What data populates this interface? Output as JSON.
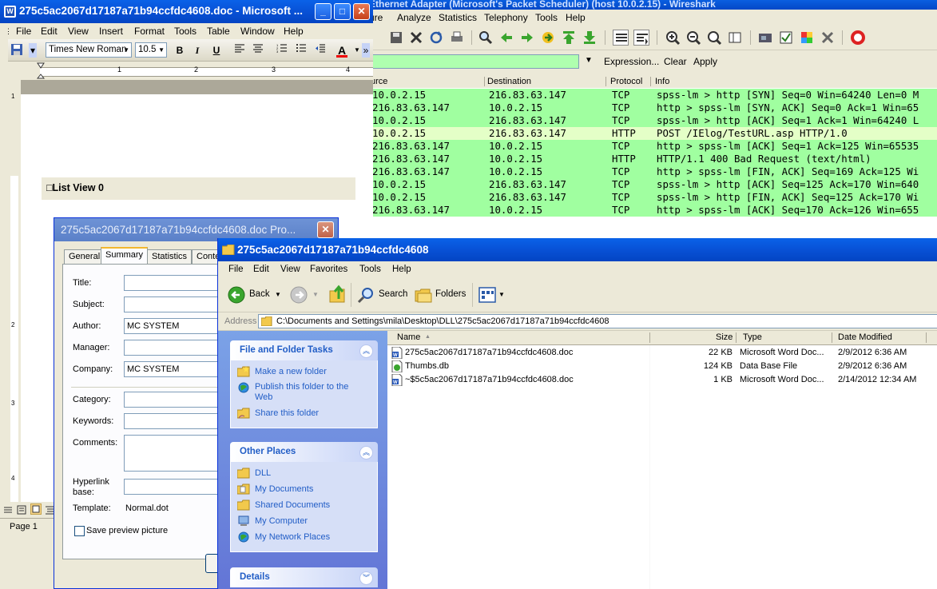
{
  "wireshark": {
    "title_fragment": "Ethernet Adapter (Microsoft's Packet Scheduler)  (host 10.0.2.15) - Wireshark",
    "menu": [
      "ure",
      "Analyze",
      "Statistics",
      "Telephony",
      "Tools",
      "Help"
    ],
    "filter": {
      "value": "",
      "expression_label": "Expression...",
      "clear_label": "Clear",
      "apply_label": "Apply"
    },
    "columns": {
      "source": "urce",
      "destination": "Destination",
      "protocol": "Protocol",
      "info": "Info"
    },
    "row_colors": {
      "tcp": "#a0ffa0",
      "http": "#e4ffc7"
    },
    "packets": [
      {
        "src": "10.0.2.15",
        "dst": "216.83.63.147",
        "proto": "TCP",
        "info": "spss-lm > http [SYN] Seq=0 Win=64240 Len=0 M",
        "kind": "tcp"
      },
      {
        "src": "216.83.63.147",
        "dst": "10.0.2.15",
        "proto": "TCP",
        "info": "http > spss-lm [SYN, ACK] Seq=0 Ack=1 Win=65",
        "kind": "tcp"
      },
      {
        "src": "10.0.2.15",
        "dst": "216.83.63.147",
        "proto": "TCP",
        "info": "spss-lm > http [ACK] Seq=1 Ack=1 Win=64240 L",
        "kind": "tcp"
      },
      {
        "src": "10.0.2.15",
        "dst": "216.83.63.147",
        "proto": "HTTP",
        "info": "POST /IElog/TestURL.asp HTTP/1.0",
        "kind": "http"
      },
      {
        "src": "216.83.63.147",
        "dst": "10.0.2.15",
        "proto": "TCP",
        "info": "http > spss-lm [ACK] Seq=1 Ack=125 Win=65535",
        "kind": "tcp"
      },
      {
        "src": "216.83.63.147",
        "dst": "10.0.2.15",
        "proto": "HTTP",
        "info": "HTTP/1.1 400 Bad Request  (text/html)",
        "kind": "tcp"
      },
      {
        "src": "216.83.63.147",
        "dst": "10.0.2.15",
        "proto": "TCP",
        "info": "http > spss-lm [FIN, ACK] Seq=169 Ack=125 Wi",
        "kind": "tcp"
      },
      {
        "src": "10.0.2.15",
        "dst": "216.83.63.147",
        "proto": "TCP",
        "info": "spss-lm > http [ACK] Seq=125 Ack=170 Win=640",
        "kind": "tcp"
      },
      {
        "src": "10.0.2.15",
        "dst": "216.83.63.147",
        "proto": "TCP",
        "info": "spss-lm > http [FIN, ACK] Seq=125 Ack=170 Wi",
        "kind": "tcp"
      },
      {
        "src": "216.83.63.147",
        "dst": "10.0.2.15",
        "proto": "TCP",
        "info": "http > spss-lm [ACK] Seq=170 Ack=126 Win=655",
        "kind": "tcp"
      }
    ]
  },
  "word": {
    "title": "275c5ac2067d17187a71b94ccfdc4608.doc - Microsoft ...",
    "menu": [
      "File",
      "Edit",
      "View",
      "Insert",
      "Format",
      "Tools",
      "Table",
      "Window",
      "Help"
    ],
    "font_name": "Times New Roman",
    "font_size": "10.5",
    "bold_label": "B",
    "italic_label": "I",
    "underline_label": "U",
    "font_color_label": "A",
    "ruler_numbers": [
      "1",
      "2",
      "3",
      "4"
    ],
    "vruler_numbers": [
      "1",
      "2",
      "3",
      "4"
    ],
    "list_view_label": "□List View 0",
    "status_page": "Page  1"
  },
  "properties": {
    "title": "275c5ac2067d17187a71b94ccfdc4608.doc Pro...",
    "tabs": [
      "General",
      "Summary",
      "Statistics",
      "Conte"
    ],
    "fields": {
      "title_label": "Title:",
      "title_value": "",
      "subject_label": "Subject:",
      "subject_value": "",
      "author_label": "Author:",
      "author_value": "MC SYSTEM",
      "manager_label": "Manager:",
      "manager_value": "",
      "company_label": "Company:",
      "company_value": "MC SYSTEM",
      "category_label": "Category:",
      "category_value": "",
      "keywords_label": "Keywords:",
      "keywords_value": "",
      "comments_label": "Comments:",
      "comments_value": "",
      "hyperlink_label": "Hyperlink base:",
      "hyperlink_value": "",
      "template_label": "Template:",
      "template_value": "Normal.dot"
    },
    "save_preview_label": "Save preview picture"
  },
  "explorer": {
    "title": "275c5ac2067d17187a71b94ccfdc4608",
    "menu": [
      "File",
      "Edit",
      "View",
      "Favorites",
      "Tools",
      "Help"
    ],
    "back_label": "Back",
    "search_label": "Search",
    "folders_label": "Folders",
    "address_label": "Address",
    "address_value": "C:\\Documents and Settings\\mila\\Desktop\\DLL\\275c5ac2067d17187a71b94ccfdc4608",
    "file_tasks": {
      "title": "File and Folder Tasks",
      "items": [
        "Make a new folder",
        "Publish this folder to the Web",
        "Share this folder"
      ]
    },
    "other_places": {
      "title": "Other Places",
      "items": [
        "DLL",
        "My Documents",
        "Shared Documents",
        "My Computer",
        "My Network Places"
      ]
    },
    "details_title": "Details",
    "columns": {
      "name": "Name",
      "size": "Size",
      "type": "Type",
      "modified": "Date Modified"
    },
    "files": [
      {
        "name": "275c5ac2067d17187a71b94ccfdc4608.doc",
        "size": "22 KB",
        "type": "Microsoft Word Doc...",
        "modified": "2/9/2012 6:36 AM",
        "icon": "word-doc-icon"
      },
      {
        "name": "Thumbs.db",
        "size": "124 KB",
        "type": "Data Base File",
        "modified": "2/9/2012 6:36 AM",
        "icon": "db-file-icon"
      },
      {
        "name": "~$5c5ac2067d17187a71b94ccfdc4608.doc",
        "size": "1 KB",
        "type": "Microsoft Word Doc...",
        "modified": "2/14/2012 12:34 AM",
        "icon": "word-doc-icon"
      }
    ]
  }
}
